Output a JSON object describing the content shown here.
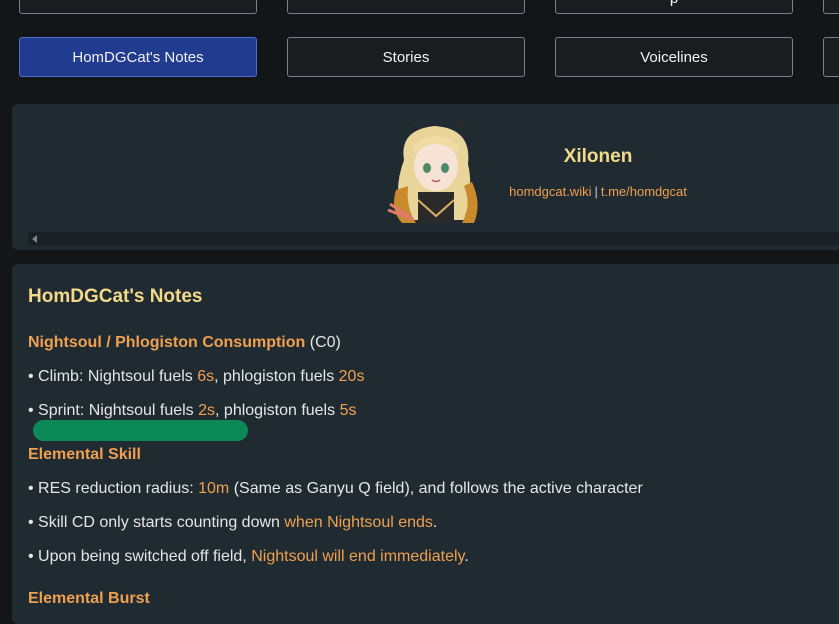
{
  "nav": {
    "top_row_labels": [
      "",
      "",
      "p",
      ""
    ],
    "buttons": [
      {
        "label": "HomDGCat's Notes",
        "active": true
      },
      {
        "label": "Stories",
        "active": false
      },
      {
        "label": "Voicelines",
        "active": false
      },
      {
        "label": "",
        "active": false
      }
    ]
  },
  "profile": {
    "name": "Xilonen",
    "link1": "homdgcat.wiki",
    "separator": "|",
    "link2": "t.me/homdgcat",
    "avatar_icon": "character-portrait"
  },
  "notes": {
    "title": "HomDGCat's Notes",
    "section1": {
      "title": "Nightsoul / Phlogiston Consumption",
      "suffix": " (C0)",
      "climb": {
        "prefix": "• Climb: Nightsoul fuels ",
        "v1": "6s",
        "mid": ", phlogiston fuels ",
        "v2": "20s"
      },
      "sprint": {
        "prefix": "• Sprint: Nightsoul fuels ",
        "v1": "2s",
        "mid": ", phlogiston fuels ",
        "v2": "5s"
      }
    },
    "section2": {
      "title": "Elemental Skill",
      "res": {
        "prefix": "• RES reduction radius: ",
        "v": "10m",
        "suffix": " (Same as Ganyu Q field), and follows the active character"
      },
      "cd": {
        "prefix": "• Skill CD only starts counting down ",
        "hl": "when Nightsoul ends",
        "suffix": "."
      },
      "switch": {
        "prefix": "• Upon being switched off field, ",
        "hl": "Nightsoul will end immediately",
        "suffix": "."
      }
    },
    "section3": {
      "title": "Elemental Burst"
    }
  },
  "colors": {
    "background": "#121619",
    "card": "#1f2a31",
    "accent_orange": "#f0a050",
    "accent_yellow": "#f3d98a",
    "active_button": "#213b8f",
    "highlight_marker": "#0b8a57"
  }
}
